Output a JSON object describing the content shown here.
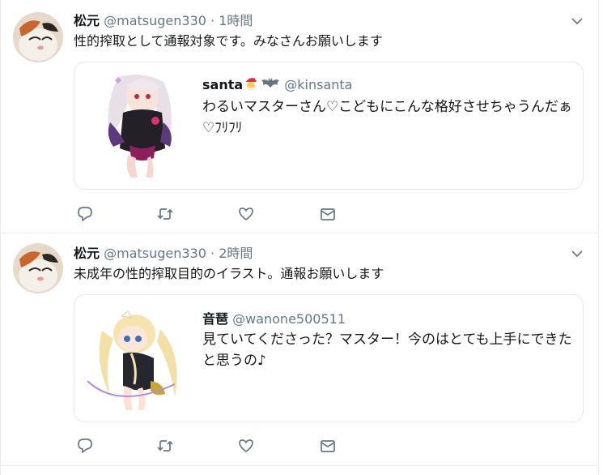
{
  "tweets": [
    {
      "name": "松元",
      "handle": "@matsugen330",
      "dot": "·",
      "time": "1時間",
      "text": "性的搾取として通報対象です。みなさんお願いします",
      "quote": {
        "name": "santa",
        "handle": "@kinsanta",
        "text": "わるいマスターさん♡こどもにこんな格好させちゃうんだぁ♡ﾌﾘﾌﾘ"
      }
    },
    {
      "name": "松元",
      "handle": "@matsugen330",
      "dot": "·",
      "time": "2時間",
      "text": "未成年の性的搾取目的のイラスト。通報お願いします",
      "quote": {
        "name": "音琶",
        "handle": "@wanone500511",
        "text": "見ていてくださった？マスター！今のはとても上手にできたと思うの♪"
      }
    }
  ],
  "colors": {
    "text": "#14171a",
    "muted": "#657786",
    "border": "#e1e8ed"
  }
}
